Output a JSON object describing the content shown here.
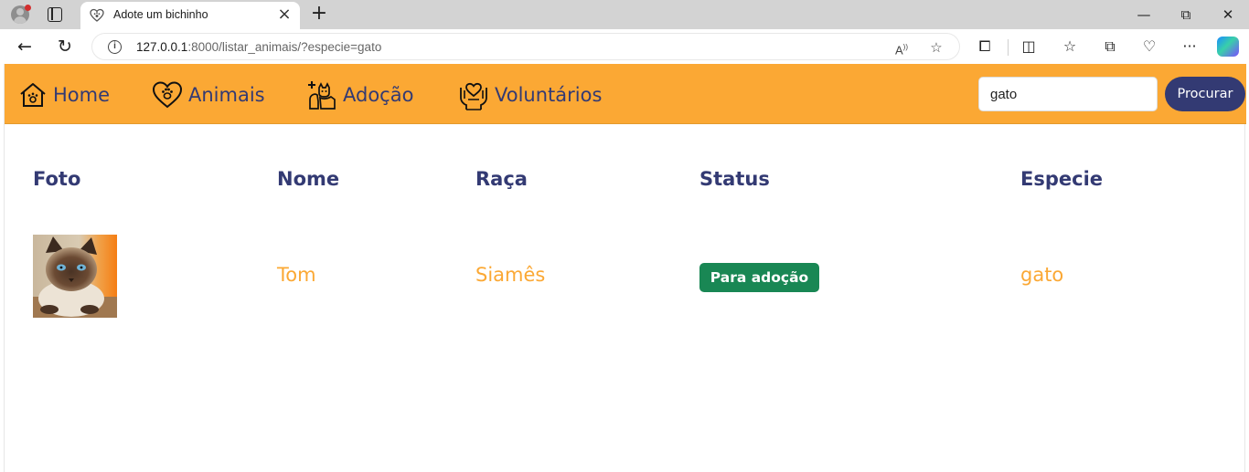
{
  "browser": {
    "tab_title": "Adote um bichinho",
    "url_host": "127.0.0.1",
    "url_rest": ":8000/listar_animais/?especie=gato",
    "icons": [
      "profile-icon",
      "tab-actions-icon",
      "favicon-icon",
      "close-icon",
      "new-tab-icon",
      "minimize-icon",
      "restore-icon",
      "window-close-icon",
      "back-icon",
      "reload-icon",
      "info-icon",
      "read-aloud-icon",
      "favorite-star-icon",
      "extensions-icon",
      "split-screen-icon",
      "favorites-icon",
      "collections-icon",
      "browser-essentials-icon",
      "more-icon",
      "copilot-icon"
    ]
  },
  "nav": {
    "items": [
      {
        "label": "Home",
        "icon": "house-paw-icon"
      },
      {
        "label": "Animais",
        "icon": "heart-paw-icon"
      },
      {
        "label": "Adoção",
        "icon": "dog-cat-icon"
      },
      {
        "label": "Voluntários",
        "icon": "hands-heart-icon"
      }
    ],
    "search_value": "gato",
    "search_button": "Procurar"
  },
  "table": {
    "headers": [
      "Foto",
      "Nome",
      "Raça",
      "Status",
      "Especie"
    ],
    "rows": [
      {
        "nome": "Tom",
        "raca": "Siamês",
        "status": "Para adoção",
        "especie": "gato",
        "photo": "siamese-cat-photo"
      }
    ]
  },
  "colors": {
    "nav_background": "#fba834",
    "primary": "#333a73",
    "accent_text": "#fba834",
    "status_badge": "#198754"
  }
}
